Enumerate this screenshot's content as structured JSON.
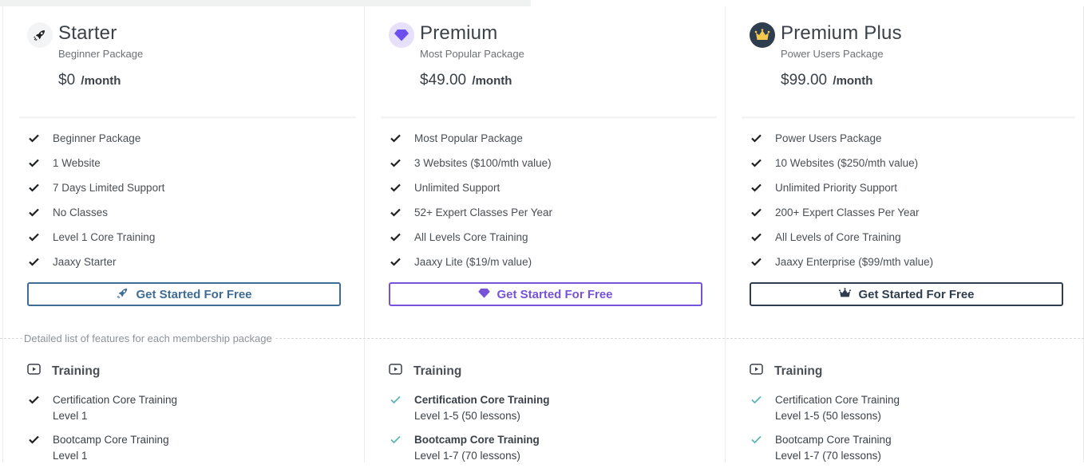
{
  "colors": {
    "starter_accent": "#3e6c94",
    "premium_accent": "#7653d8",
    "plus_accent": "#2f3e4f",
    "crown_gold": "#f4c94f",
    "teal_check": "#5fb3b3"
  },
  "plans": [
    {
      "icon": "rocket-icon",
      "title": "Starter",
      "subtitle": "Beginner Package",
      "price": "$0",
      "period": "/month",
      "features": [
        "Beginner Package",
        "1 Website",
        "7 Days Limited Support",
        "No Classes",
        "Level 1 Core Training",
        "Jaaxy Starter"
      ],
      "cta": "Get Started For Free",
      "training": [
        {
          "name": "Certification Core Training",
          "detail": "Level 1"
        },
        {
          "name": "Bootcamp Core Training",
          "detail": "Level 1"
        }
      ]
    },
    {
      "icon": "diamond-icon",
      "title": "Premium",
      "subtitle": "Most Popular Package",
      "price": "$49.00",
      "period": "/month",
      "features": [
        "Most Popular Package",
        "3 Websites ($100/mth value)",
        "Unlimited Support",
        "52+ Expert Classes Per Year",
        "All Levels Core Training",
        "Jaaxy Lite ($19/m value)"
      ],
      "cta": "Get Started For Free",
      "training": [
        {
          "name": "Certification Core Training",
          "detail": "Level 1-5 (50 lessons)"
        },
        {
          "name": "Bootcamp Core Training",
          "detail": "Level 1-7 (70 lessons)"
        }
      ]
    },
    {
      "icon": "crown-icon",
      "title": "Premium Plus",
      "subtitle": "Power Users Package",
      "price": "$99.00",
      "period": "/month",
      "features": [
        "Power Users Package",
        "10 Websites ($250/mth value)",
        "Unlimited Priority Support",
        "200+ Expert Classes Per Year",
        "All Levels of Core Training",
        "Jaaxy Enterprise ($99/mth value)"
      ],
      "cta": "Get Started For Free",
      "training": [
        {
          "name": "Certification Core Training",
          "detail": "Level 1-5 (50 lessons)"
        },
        {
          "name": "Bootcamp Core Training",
          "detail": "Level 1-7 (70 lessons)"
        }
      ]
    }
  ],
  "divider_note": "Detailed list of features for each membership package",
  "section_title": "Training"
}
